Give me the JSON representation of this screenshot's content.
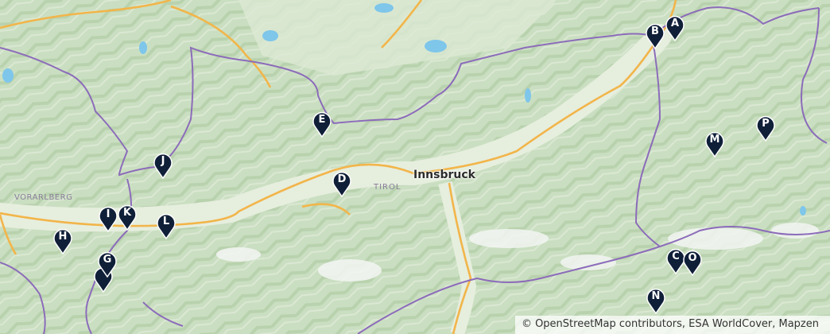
{
  "map": {
    "city_label": "Innsbruck",
    "regions": {
      "tirol": "TIROL",
      "vorarlberg": "VORARLBERG"
    },
    "attribution": "© OpenStreetMap contributors, ESA WorldCover, Mapzen",
    "colors": {
      "land": "#cfe2c6",
      "valley": "#e4eddc",
      "water": "#7ec6ea",
      "highway": "#f2b54a",
      "border": "#8c6cba",
      "marker": "#0f1f38"
    }
  },
  "markers": [
    {
      "label": "A"
    },
    {
      "label": "B"
    },
    {
      "label": "C"
    },
    {
      "label": "D"
    },
    {
      "label": "E"
    },
    {
      "label": "G"
    },
    {
      "label": "H"
    },
    {
      "label": "I"
    },
    {
      "label": "J"
    },
    {
      "label": "K"
    },
    {
      "label": "L"
    },
    {
      "label": "M"
    },
    {
      "label": "N"
    },
    {
      "label": "O"
    },
    {
      "label": "P"
    }
  ]
}
